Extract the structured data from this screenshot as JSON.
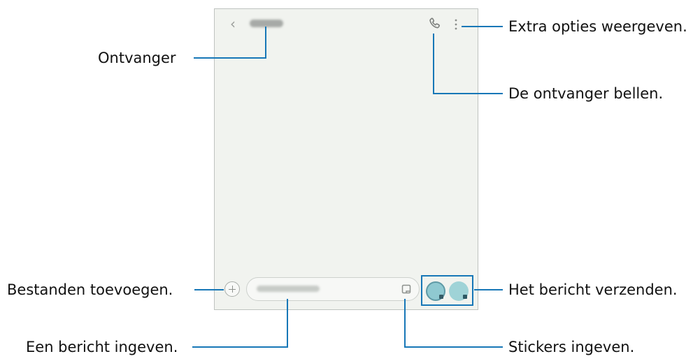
{
  "labels": {
    "recipient": "Ontvanger",
    "more_options": "Extra opties weergeven.",
    "call_recipient": "De ontvanger bellen.",
    "add_files": "Bestanden toevoegen.",
    "send_message": "Het bericht verzenden.",
    "enter_message": "Een bericht ingeven.",
    "enter_stickers": "Stickers ingeven."
  },
  "colors": {
    "callout_line": "#1777b7",
    "screen_bg": "#f1f3ef",
    "label_text": "#111111"
  },
  "icons": {
    "back": "chevron-left-icon",
    "call": "phone-icon",
    "more": "more-vertical-icon",
    "add": "plus-icon",
    "sticker": "sticker-icon",
    "send": "send-icon"
  }
}
